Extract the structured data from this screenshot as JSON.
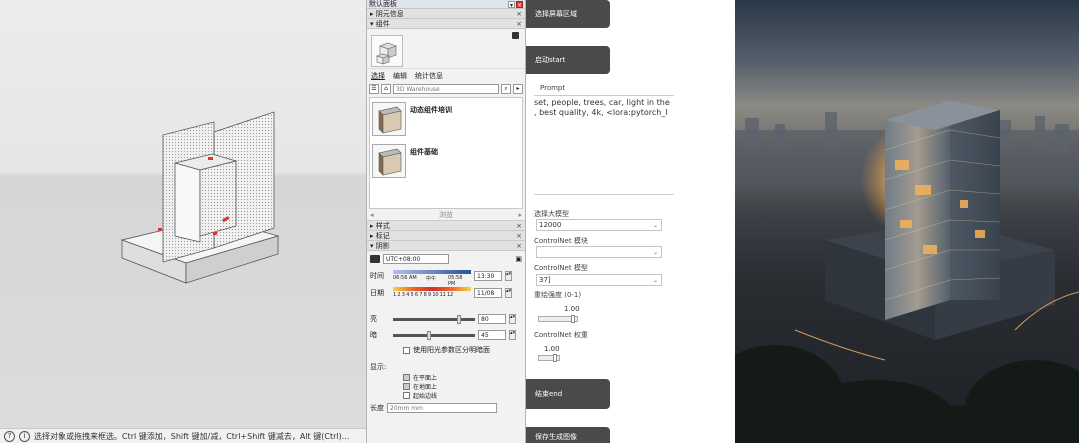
{
  "tray": {
    "title": "默认面板",
    "sections": {
      "shadows_info": "阴元信息",
      "components": "组件",
      "styles": "样式",
      "tags": "标记",
      "shadows": "阴影"
    },
    "tabs": [
      "选择",
      "编辑",
      "统计信息"
    ],
    "search_placeholder": "3D Warehouse",
    "items": [
      "动态组件培训",
      "组件基础"
    ],
    "nav_label": "浏览",
    "shadow": {
      "timezone": "UTC+08:00",
      "time_label": "时间",
      "time_start": "06:56 AM",
      "time_mid": "中午",
      "time_end": "05:58 PM",
      "time_value": "13:30",
      "date_label": "日期",
      "months": "1 2 3 4 5 6 7 8 9 10 11 12",
      "date_value": "11/08",
      "light_label": "亮",
      "light_value": "80",
      "dark_label": "暗",
      "dark_value": "45",
      "use_sun_label": "使用阳光参数区分明暗面",
      "display_label": "显示:",
      "on_faces": "在平面上",
      "on_ground": "在地面上",
      "from_edges": "起始边线",
      "units_label": "长度",
      "units_value": "20mm mm"
    }
  },
  "status": {
    "text": "选择对象或拖拽来框选。Ctrl 键添加，Shift 键加/减，Ctrl+Shift 键减去，Alt 键(Ctrl)..."
  },
  "webui": {
    "btn_select_area": "选择屏幕区域",
    "btn_start": "启动start",
    "prompt_label": "Prompt",
    "prompt_text": "set, people, trees, car, light in the\n, best quality, 4k, <lora:pytorch_l",
    "model_label": "选择大模型",
    "model_value": "12000",
    "controlnet_module_label": "ControlNet 模块",
    "controlnet_module_value": "",
    "controlnet_model_label": "ControlNet 模型",
    "controlnet_model_value": "37]",
    "denoise_label": "重绘强度 (0-1)",
    "denoise_value": "1.00",
    "controlnet_weight_label": "ControlNet 权重",
    "controlnet_weight_value": "1.00",
    "btn_end": "结束end",
    "btn_save": "保存生成图像"
  },
  "colors": {
    "dark_button": "#4a4a4a",
    "tray_bg": "#f2f2f2",
    "close_red": "#d93a3a"
  },
  "icons": {
    "lock": "lock-icon",
    "home": "home-icon",
    "search": "search-icon",
    "sun": "sun-icon",
    "close": "close-icon"
  }
}
